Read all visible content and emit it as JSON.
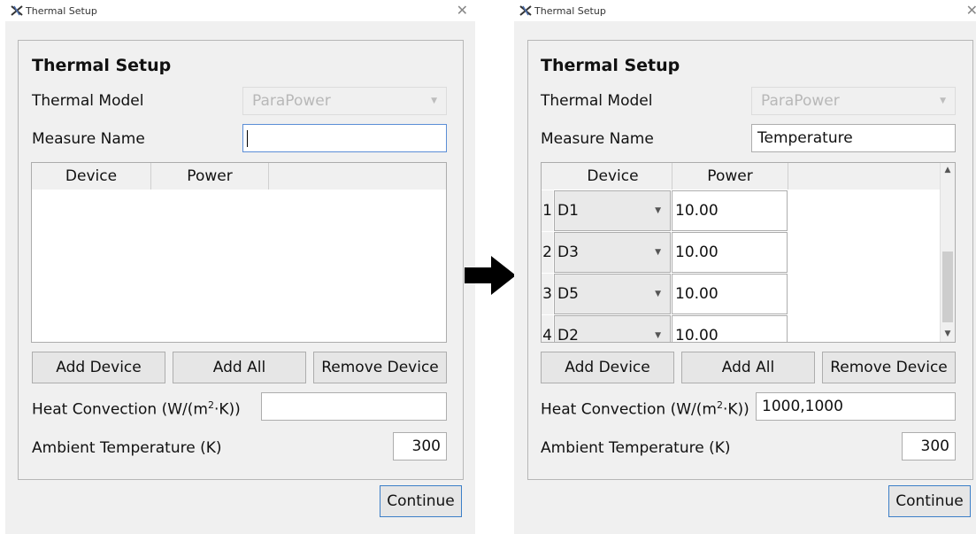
{
  "left_dialog": {
    "title_bar": "Thermal Setup",
    "heading": "Thermal Setup",
    "thermal_model_label": "Thermal Model",
    "thermal_model_value": "ParaPower",
    "measure_name_label": "Measure Name",
    "measure_name_value": "",
    "table": {
      "headers": [
        "Device",
        "Power"
      ],
      "rows": []
    },
    "add_device": "Add Device",
    "add_all": "Add All",
    "remove_device": "Remove Device",
    "heat_convection_label": "Heat Convection (W/(m",
    "heat_convection_sup": "2",
    "heat_convection_suffix": "·K))",
    "heat_convection_value": "",
    "ambient_label": "Ambient Temperature (K)",
    "ambient_value": "300",
    "continue": "Continue"
  },
  "right_dialog": {
    "title_bar": "Thermal Setup",
    "heading": "Thermal Setup",
    "thermal_model_label": "Thermal Model",
    "thermal_model_value": "ParaPower",
    "measure_name_label": "Measure Name",
    "measure_name_value": "Temperature",
    "table": {
      "headers": [
        "Device",
        "Power"
      ],
      "rows": [
        {
          "num": "1",
          "device": "D1",
          "power": "10.00"
        },
        {
          "num": "2",
          "device": "D3",
          "power": "10.00"
        },
        {
          "num": "3",
          "device": "D5",
          "power": "10.00"
        },
        {
          "num": "4",
          "device": "D2",
          "power": "10.00"
        }
      ]
    },
    "add_device": "Add Device",
    "add_all": "Add All",
    "remove_device": "Remove Device",
    "heat_convection_label": "Heat Convection (W/(m",
    "heat_convection_sup": "2",
    "heat_convection_suffix": "·K))",
    "heat_convection_value": "1000,1000",
    "ambient_label": "Ambient Temperature (K)",
    "ambient_value": "300",
    "continue": "Continue"
  },
  "icons": {
    "app": "app-logo-icon",
    "close": "close-icon",
    "dropdown": "chevron-down-icon",
    "transition": "arrow-right-icon"
  },
  "colors": {
    "dialog_bg": "#f0f0f0",
    "focus_border": "#5b8ed6",
    "disabled_text": "#b8b8b8"
  }
}
